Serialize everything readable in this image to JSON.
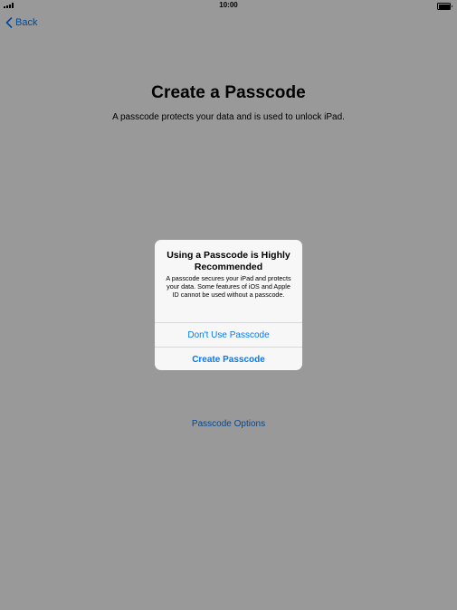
{
  "status_bar": {
    "time": "10:00"
  },
  "nav": {
    "back_label": "Back"
  },
  "page": {
    "title": "Create a Passcode",
    "subtitle": "A passcode protects your data and is used to unlock iPad.",
    "options_label": "Passcode Options"
  },
  "alert": {
    "title": "Using a Passcode is Highly Recommended",
    "message": "A passcode secures your iPad and protects your data. Some features of iOS and Apple ID cannot be used without a passcode.",
    "buttons": [
      {
        "label": "Don't Use Passcode"
      },
      {
        "label": "Create Passcode"
      }
    ]
  },
  "colors": {
    "accent": "#007aff",
    "overlay": "rgba(0,0,0,0.40)",
    "alert_background": "#f7f7f7"
  },
  "icons": {
    "back": "chevron-left-icon",
    "signal": "cellular-signal-icon",
    "battery": "battery-icon"
  }
}
